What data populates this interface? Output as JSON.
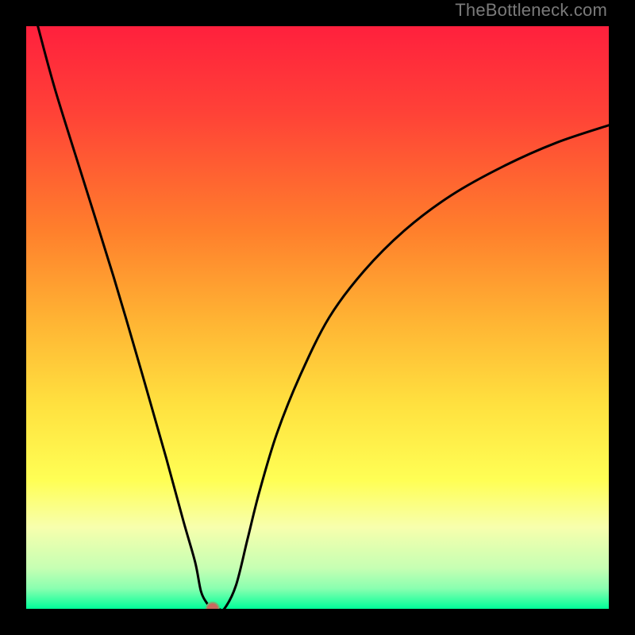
{
  "watermark": "TheBottleneck.com",
  "colors": {
    "curve": "#000000",
    "dot_fill": "#c96a5f",
    "dot_stroke": "#78b376",
    "gradient_stops": [
      {
        "offset": 0.0,
        "color": "#ff203d"
      },
      {
        "offset": 0.15,
        "color": "#ff4237"
      },
      {
        "offset": 0.35,
        "color": "#ff7f2c"
      },
      {
        "offset": 0.5,
        "color": "#ffb233"
      },
      {
        "offset": 0.65,
        "color": "#ffe13f"
      },
      {
        "offset": 0.78,
        "color": "#ffff55"
      },
      {
        "offset": 0.86,
        "color": "#f7ffad"
      },
      {
        "offset": 0.93,
        "color": "#c6ffb3"
      },
      {
        "offset": 0.965,
        "color": "#8affb0"
      },
      {
        "offset": 1.0,
        "color": "#00ff99"
      }
    ]
  },
  "chart_data": {
    "type": "line",
    "title": "",
    "xlabel": "",
    "ylabel": "",
    "xlim": [
      0,
      100
    ],
    "ylim": [
      0,
      100
    ],
    "grid": false,
    "legend": false,
    "series": [
      {
        "name": "bottleneck-curve",
        "x": [
          2,
          5,
          10,
          15,
          20,
          24,
          27,
          29,
          30,
          31,
          32,
          33,
          34,
          36,
          38,
          40,
          43,
          47,
          52,
          58,
          65,
          73,
          82,
          91,
          100
        ],
        "y": [
          100,
          89,
          73,
          57,
          40,
          26,
          15,
          8,
          3,
          1,
          0,
          0,
          0,
          4,
          12,
          20,
          30,
          40,
          50,
          58,
          65,
          71,
          76,
          80,
          83
        ]
      }
    ],
    "annotations": [
      {
        "type": "dot",
        "name": "minimum-marker",
        "x": 32,
        "y": 0,
        "radius_px": 8
      }
    ]
  }
}
